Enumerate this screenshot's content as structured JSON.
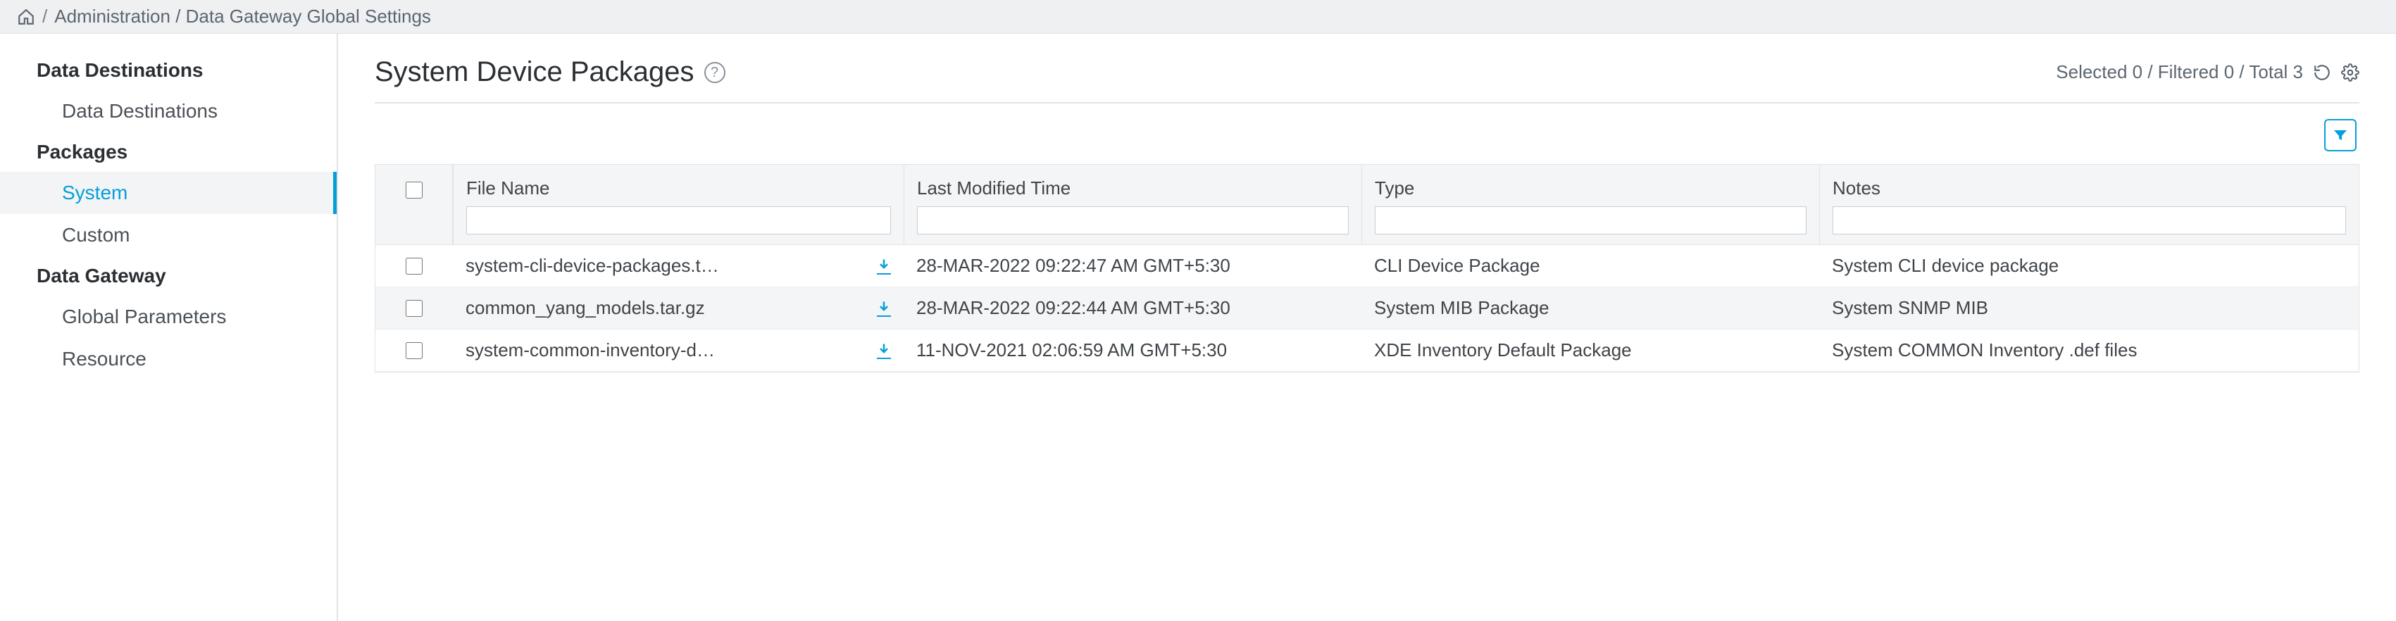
{
  "breadcrumb": {
    "path_text": "Administration / Data Gateway Global Settings"
  },
  "sidebar": {
    "groups": [
      {
        "title": "Data Destinations",
        "items": [
          {
            "label": "Data Destinations",
            "active": false
          }
        ]
      },
      {
        "title": "Packages",
        "items": [
          {
            "label": "System",
            "active": true
          },
          {
            "label": "Custom",
            "active": false
          }
        ]
      },
      {
        "title": "Data Gateway",
        "items": [
          {
            "label": "Global Parameters",
            "active": false
          },
          {
            "label": "Resource",
            "active": false
          }
        ]
      }
    ]
  },
  "page": {
    "title": "System Device Packages",
    "counts_text": "Selected 0 / Filtered 0 / Total 3"
  },
  "table": {
    "columns": {
      "file_name": "File Name",
      "last_modified": "Last Modified Time",
      "type": "Type",
      "notes": "Notes"
    },
    "filters": {
      "file_name": "",
      "last_modified": "",
      "type": "",
      "notes": ""
    },
    "rows": [
      {
        "file_name": "system-cli-device-packages.t…",
        "last_modified": "28-MAR-2022 09:22:47 AM GMT+5:30",
        "type": "CLI Device Package",
        "notes": "System CLI device package"
      },
      {
        "file_name": "common_yang_models.tar.gz",
        "last_modified": "28-MAR-2022 09:22:44 AM GMT+5:30",
        "type": "System MIB Package",
        "notes": "System SNMP MIB"
      },
      {
        "file_name": "system-common-inventory-d…",
        "last_modified": "11-NOV-2021 02:06:59 AM GMT+5:30",
        "type": "XDE Inventory Default Package",
        "notes": "System COMMON Inventory .def files"
      }
    ]
  }
}
